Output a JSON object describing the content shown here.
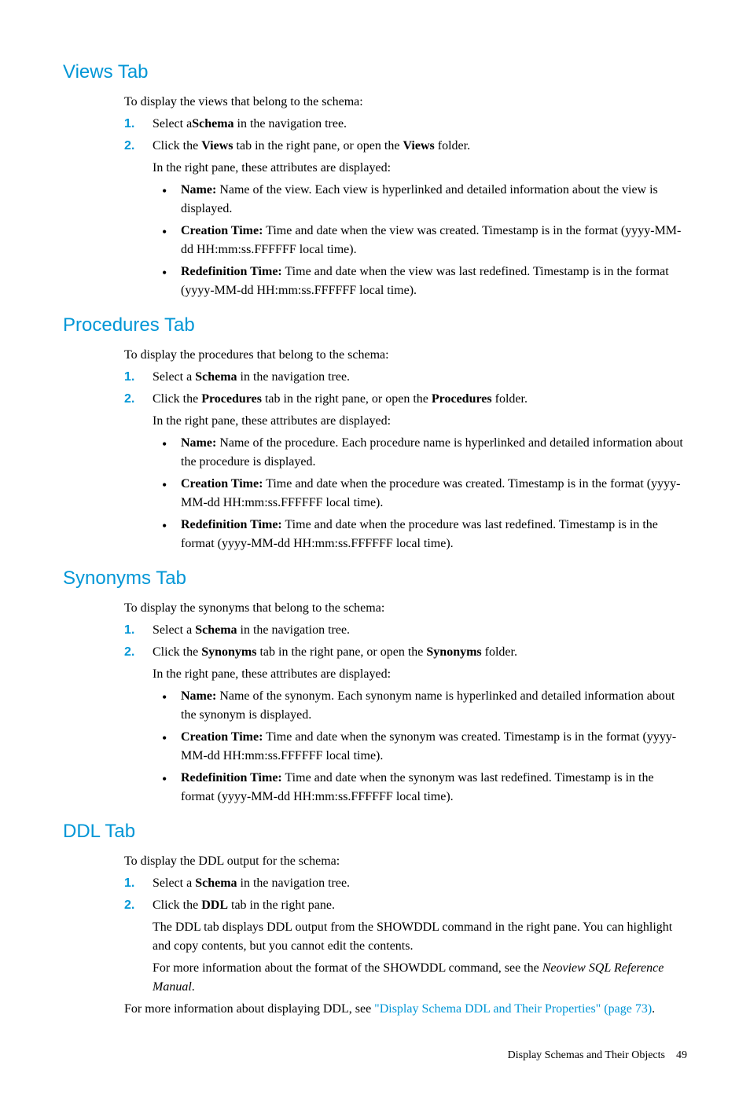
{
  "sections": {
    "views": {
      "heading": "Views Tab",
      "intro": "To display the views that belong to the schema:",
      "step1_prefix": "Select a",
      "step1_bold": "Schema",
      "step1_suffix": " in the navigation tree.",
      "step2_prefix": "Click the ",
      "step2_bold1": "Views",
      "step2_mid": " tab in the right pane, or open the ",
      "step2_bold2": "Views",
      "step2_suffix": " folder.",
      "attrs_intro": "In the right pane, these attributes are displayed:",
      "b1_label": "Name:",
      "b1_text": " Name of the view. Each view is hyperlinked and detailed information about the view is displayed.",
      "b2_label": "Creation Time:",
      "b2_text": " Time and date when the view was created. Timestamp is in the format (yyyy-MM-dd HH:mm:ss.FFFFFF local time).",
      "b3_label": "Redefinition Time:",
      "b3_text": " Time and date when the view was last redefined. Timestamp is in the format (yyyy-MM-dd HH:mm:ss.FFFFFF local time)."
    },
    "procedures": {
      "heading": "Procedures Tab",
      "intro": "To display the procedures that belong to the schema:",
      "step1_prefix": "Select a ",
      "step1_bold": "Schema",
      "step1_suffix": " in the navigation tree.",
      "step2_prefix": "Click the ",
      "step2_bold1": "Procedures",
      "step2_mid": " tab in the right pane, or open the ",
      "step2_bold2": "Procedures",
      "step2_suffix": " folder.",
      "attrs_intro": "In the right pane, these attributes are displayed:",
      "b1_label": "Name:",
      "b1_text": " Name of the procedure. Each procedure name is hyperlinked and detailed information about the procedure is displayed.",
      "b2_label": "Creation Time:",
      "b2_text": " Time and date when the procedure was created. Timestamp is in the format (yyyy-MM-dd HH:mm:ss.FFFFFF local time).",
      "b3_label": "Redefinition Time:",
      "b3_text": " Time and date when the procedure was last redefined. Timestamp is in the format (yyyy-MM-dd HH:mm:ss.FFFFFF local time)."
    },
    "synonyms": {
      "heading": "Synonyms Tab",
      "intro": "To display the synonyms that belong to the schema:",
      "step1_prefix": "Select a ",
      "step1_bold": "Schema",
      "step1_suffix": " in the navigation tree.",
      "step2_prefix": "Click the ",
      "step2_bold1": "Synonyms",
      "step2_mid": " tab in the right pane, or open the ",
      "step2_bold2": "Synonyms",
      "step2_suffix": " folder.",
      "attrs_intro": "In the right pane, these attributes are displayed:",
      "b1_label": "Name:",
      "b1_text": " Name of the synonym. Each synonym name is hyperlinked and detailed information about the synonym is displayed.",
      "b2_label": "Creation Time:",
      "b2_text": " Time and date when the synonym was created. Timestamp is in the format (yyyy-MM-dd HH:mm:ss.FFFFFF local time).",
      "b3_label": "Redefinition Time:",
      "b3_text": " Time and date when the synonym was last redefined. Timestamp is in the format (yyyy-MM-dd HH:mm:ss.FFFFFF local time)."
    },
    "ddl": {
      "heading": "DDL Tab",
      "intro": "To display the DDL output for the schema:",
      "step1_prefix": "Select a ",
      "step1_bold": "Schema",
      "step1_suffix": " in the navigation tree.",
      "step2_prefix": "Click the ",
      "step2_bold": "DDL",
      "step2_suffix": " tab in the right pane.",
      "para1": "The DDL tab displays DDL output from the SHOWDDL command in the right pane. You can highlight and copy contents, but you cannot edit the contents.",
      "para2_prefix": "For more information about the format of the SHOWDDL command, see the ",
      "para2_italic": "Neoview SQL Reference Manual",
      "para2_suffix": ".",
      "outro_prefix": "For more information about displaying DDL, see ",
      "outro_link": "\"Display Schema DDL and Their Properties\" (page 73)",
      "outro_suffix": "."
    }
  },
  "footer": {
    "text": "Display Schemas and Their Objects",
    "page": "49"
  },
  "numbers": {
    "n1": "1.",
    "n2": "2."
  }
}
